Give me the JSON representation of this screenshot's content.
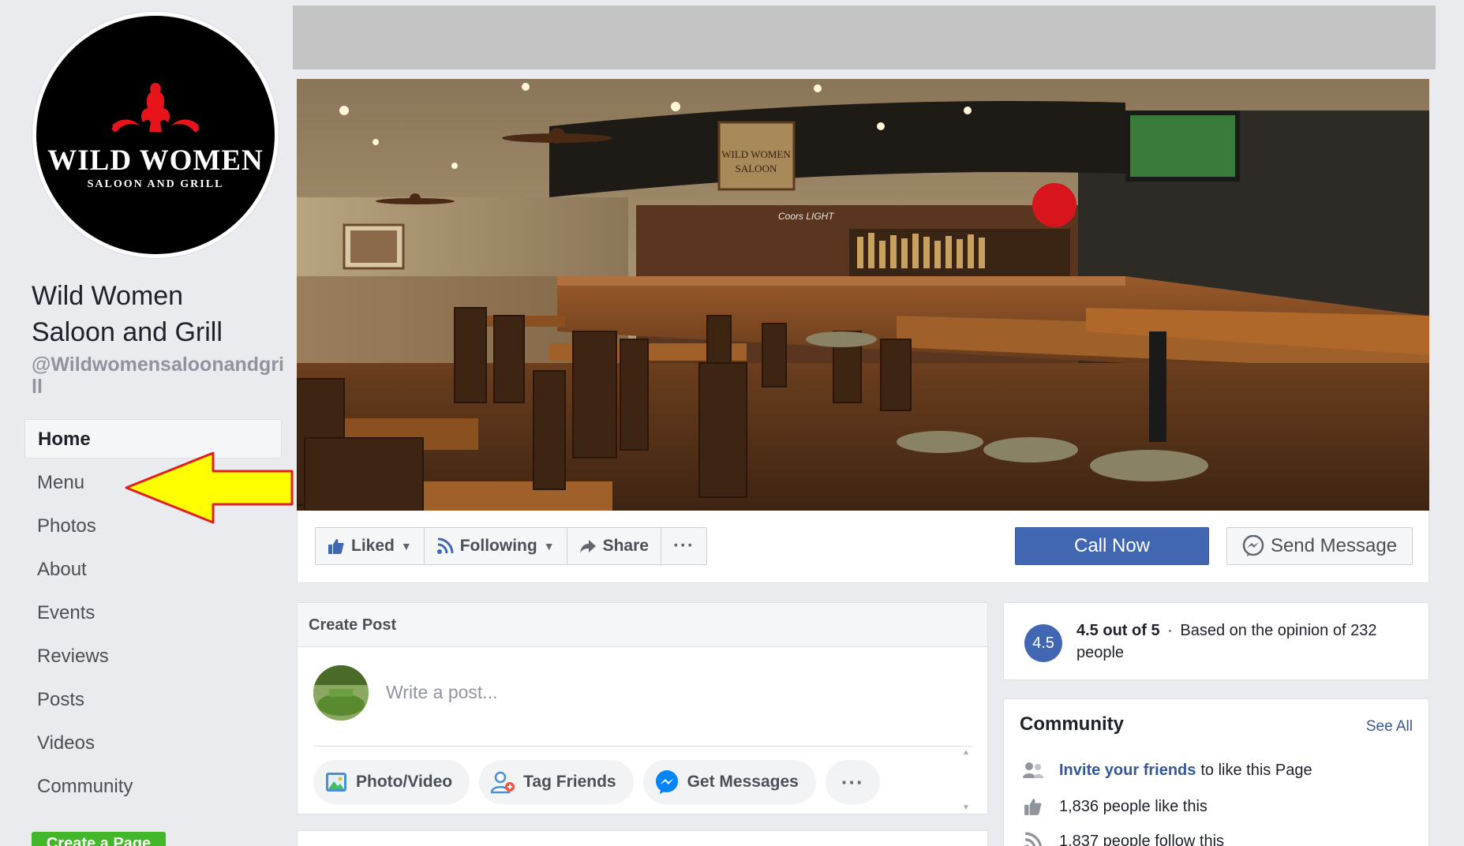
{
  "page": {
    "logo_title": "WILD WOMEN",
    "logo_subtitle": "SALOON AND GRILL",
    "name_line1": "Wild Women",
    "name_line2": "Saloon and Grill",
    "handle": "@Wildwomensaloonandgrill"
  },
  "nav": {
    "items": [
      {
        "label": "Home",
        "active": true
      },
      {
        "label": "Menu"
      },
      {
        "label": "Photos"
      },
      {
        "label": "About"
      },
      {
        "label": "Events"
      },
      {
        "label": "Reviews"
      },
      {
        "label": "Posts"
      },
      {
        "label": "Videos"
      },
      {
        "label": "Community"
      }
    ],
    "create_page_label": "Create a Page"
  },
  "cover": {
    "sign_text_1": "WILD WOMEN",
    "sign_text_2": "SALOON",
    "beer_sign": "Coors LIGHT"
  },
  "actions": {
    "liked": "Liked",
    "following": "Following",
    "share": "Share",
    "more": "···",
    "call_now": "Call Now",
    "send_message": "Send Message"
  },
  "create_post": {
    "title": "Create Post",
    "placeholder": "Write a post...",
    "photo_video": "Photo/Video",
    "tag_friends": "Tag Friends",
    "get_messages": "Get Messages",
    "more": "···"
  },
  "rating": {
    "score": "4.5",
    "headline": "4.5 out of 5",
    "separator": "·",
    "detail": "Based on the opinion of 232 people"
  },
  "community": {
    "title": "Community",
    "see_all": "See All",
    "invite_link": "Invite your friends",
    "invite_rest": "to like this Page",
    "likes": "1,836 people like this",
    "follows": "1,837 people follow this"
  },
  "colors": {
    "fb_blue": "#4267b2",
    "link_blue": "#365899",
    "background": "#e9ebee",
    "arrow_fill": "#ffff00",
    "arrow_stroke": "#e02020",
    "create_green": "#42b72a"
  }
}
